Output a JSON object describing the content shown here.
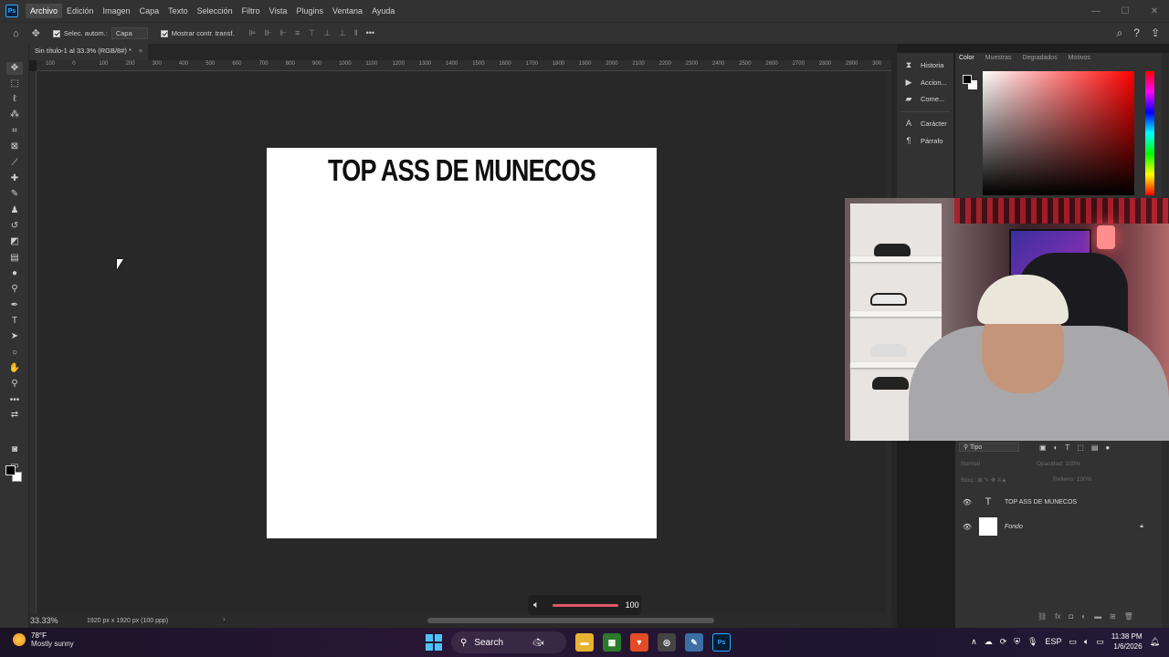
{
  "app": {
    "logo": "Ps"
  },
  "menu": {
    "items": [
      "Archivo",
      "Edición",
      "Imagen",
      "Capa",
      "Texto",
      "Selección",
      "Filtro",
      "Vista",
      "Plugins",
      "Ventana",
      "Ayuda"
    ],
    "active": "Archivo"
  },
  "options": {
    "auto_select_label": "Selec. autom.:",
    "auto_select_target": "Capa",
    "show_transform_label": "Mostrar contr. transf."
  },
  "document": {
    "tab_title": "Sin título-1 al 33.3% (RGB/8#) *",
    "close_glyph": "×",
    "zoom": "33.33%",
    "size_info": "1920 px x 1920 px (100 ppp)",
    "canvas_text": "TOP ASS DE MUNECOS"
  },
  "ruler_ticks": [
    "100",
    "0",
    "100",
    "200",
    "300",
    "400",
    "500",
    "600",
    "700",
    "800",
    "900",
    "1000",
    "1100",
    "1200",
    "1300",
    "1400",
    "1500",
    "1600",
    "1700",
    "1800",
    "1900",
    "2000",
    "2100",
    "2200",
    "2300",
    "2400",
    "2500",
    "2600",
    "2700",
    "2800",
    "2900",
    "300"
  ],
  "mid_panel": {
    "items": [
      {
        "icon": "history-icon",
        "label": "Historia"
      },
      {
        "icon": "play-icon",
        "label": "Accion..."
      },
      {
        "icon": "comment-icon",
        "label": "Come..."
      },
      {
        "icon": "character-icon",
        "label": "Carácter"
      },
      {
        "icon": "paragraph-icon",
        "label": "Párrafo"
      }
    ]
  },
  "color_panel": {
    "tabs": [
      "Color",
      "Muestras",
      "Degradados",
      "Motivos"
    ],
    "active_tab": "Color",
    "foreground": "#000000",
    "background": "#ffffff"
  },
  "layers": {
    "kind_filter": "Tipo",
    "blend_mode": "Normal",
    "opacity_label": "Opacidad:",
    "opacity_value": "100%",
    "lock_label": "Bloq.:",
    "fill_label": "Relleno:",
    "fill_value": "100%",
    "items": [
      {
        "name": "TOP ASS DE MUNECOS",
        "type": "text",
        "thumb": "T"
      },
      {
        "name": "Fondo",
        "type": "background",
        "locked": true
      }
    ]
  },
  "volume": {
    "value": "100",
    "level": 1.0
  },
  "taskbar": {
    "weather_temp": "78°F",
    "weather_desc": "Mostly sunny",
    "search_label": "Search",
    "lang": "ESP",
    "time": "11:38 PM",
    "date": "1/6/2026"
  }
}
